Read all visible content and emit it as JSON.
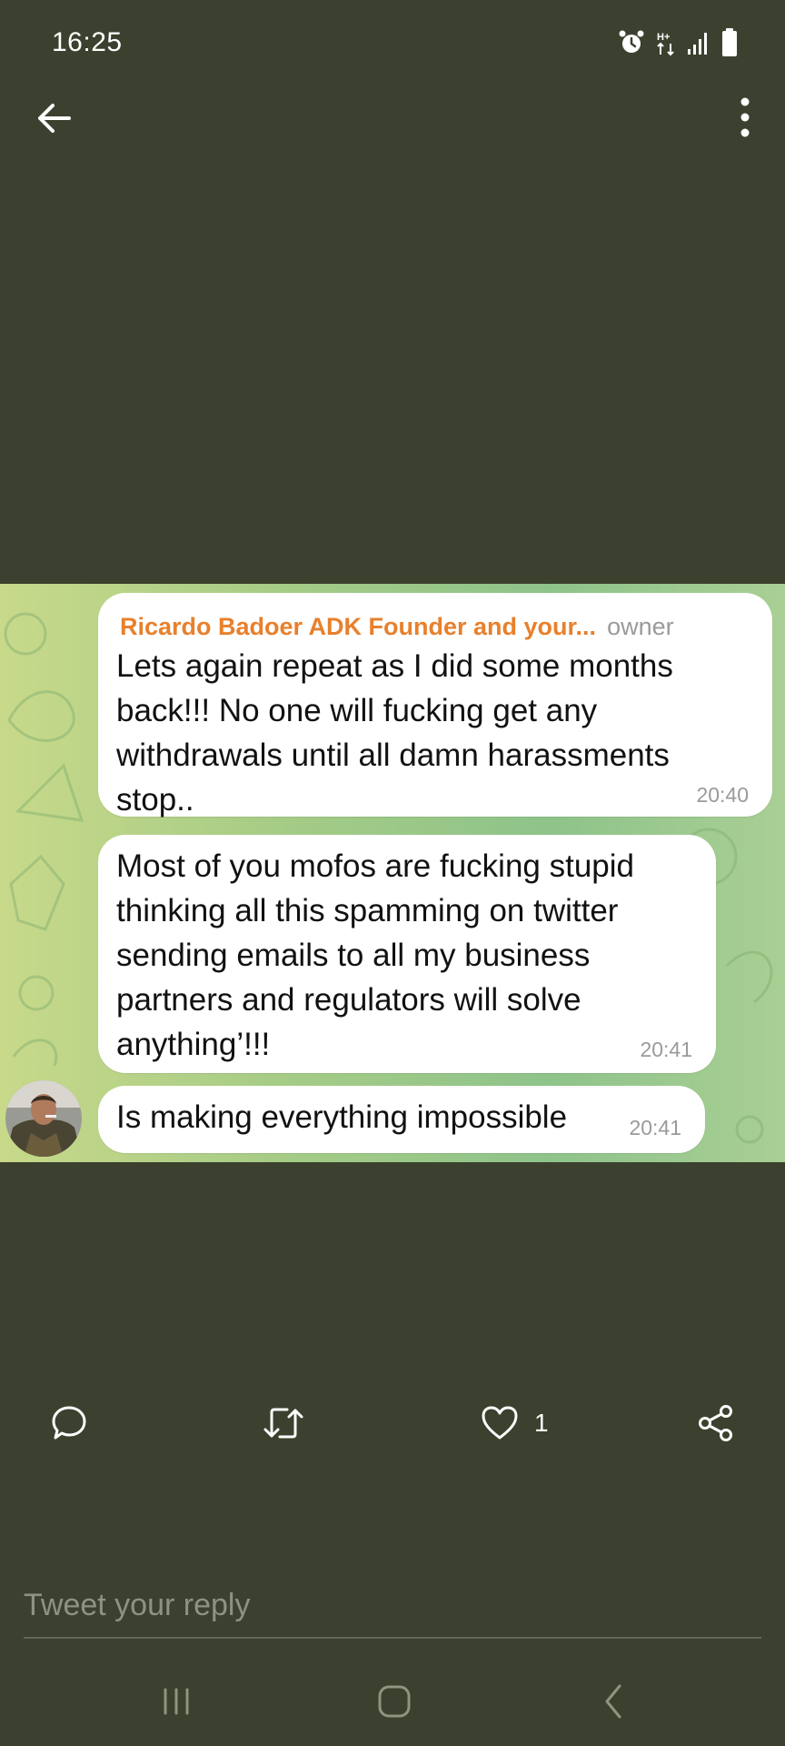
{
  "status_bar": {
    "time": "16:25",
    "icons": [
      "alarm-icon",
      "data-transfer-icon",
      "signal-icon",
      "battery-icon"
    ]
  },
  "top_nav": {
    "back_icon": "back-arrow-icon",
    "more_icon": "more-vertical-icon"
  },
  "chat": {
    "sender_name": "Ricardo Badoer ADK Founder and your...",
    "sender_role": "owner",
    "messages": [
      {
        "lines": [
          "Lets again repeat as I did some months",
          "back!!! No one will fucking get any",
          "withdrawals until all damn harassments",
          "stop.."
        ],
        "time": "20:40"
      },
      {
        "lines": [
          "Most of you mofos are fucking stupid",
          "thinking all this spamming on twitter",
          "sending emails to all my business",
          "partners and regulators will solve",
          "anything’!!!"
        ],
        "time": "20:41"
      },
      {
        "lines": [
          "Is making everything impossible"
        ],
        "time": "20:41"
      }
    ]
  },
  "actions": {
    "reply_icon": "comment-icon",
    "retweet_icon": "retweet-icon",
    "like_icon": "heart-icon",
    "like_count": "1",
    "share_icon": "share-icon"
  },
  "reply": {
    "placeholder": "Tweet your reply"
  },
  "colors": {
    "background": "#3b412e",
    "sender_name": "#e8802c",
    "chat_bg_start": "#c8d98a",
    "chat_bg_end": "#8ec38a"
  }
}
